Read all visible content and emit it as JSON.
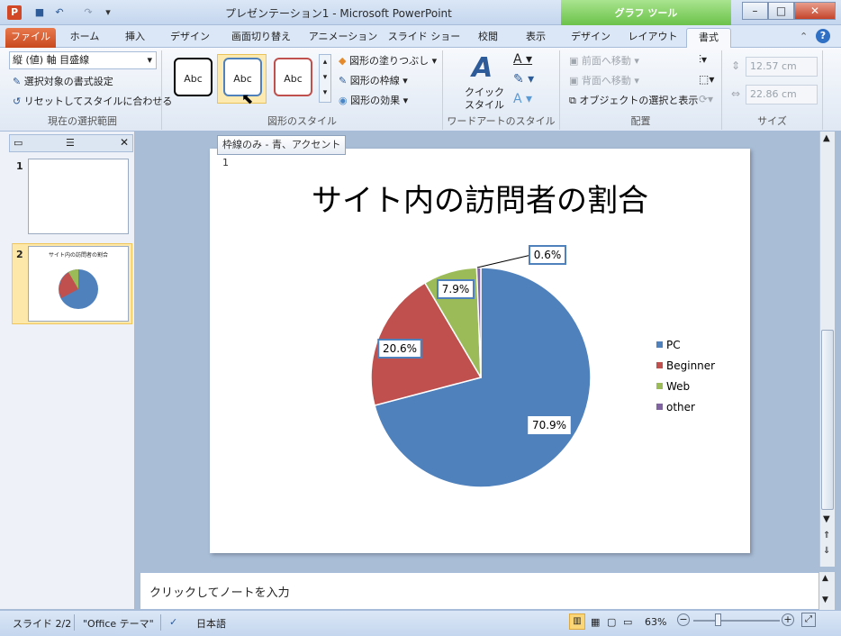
{
  "window": {
    "title": "プレゼンテーション1 - Microsoft PowerPoint",
    "context_tab_title": "グラフ ツール"
  },
  "tabs": [
    "ファイル",
    "ホーム",
    "挿入",
    "デザイン",
    "画面切り替え",
    "アニメーション",
    "スライド ショー",
    "校閲",
    "表示",
    "デザイン",
    "レイアウト",
    "書式"
  ],
  "ribbon": {
    "current_selection": {
      "combo_value": "縦 (値) 軸 目盛線",
      "format_selection": "選択対象の書式設定",
      "reset_style": "リセットしてスタイルに合わせる",
      "group_label": "現在の選択範囲"
    },
    "shape_styles": {
      "sample_text": "Abc",
      "fill": "図形の塗りつぶし",
      "outline": "図形の枠線",
      "effects": "図形の効果",
      "group_label": "図形のスタイル",
      "style_colors": [
        "#000000",
        "#4f81bd",
        "#c0504d"
      ]
    },
    "wordart": {
      "quick_style": "クイック スタイル",
      "group_label": "ワードアートのスタイル"
    },
    "arrange": {
      "bring_forward": "前面へ移動",
      "send_backward": "背面へ移動",
      "selection_pane": "オブジェクトの選択と表示",
      "group_label": "配置"
    },
    "size": {
      "height": "12.57 cm",
      "width": "22.86 cm",
      "group_label": "サイズ"
    }
  },
  "tooltip": "枠線のみ - 青、アクセント 1",
  "slides_pane": {
    "numbers": [
      "1",
      "2"
    ],
    "thumb2_title": "サイト内の訪問者の割合"
  },
  "chart_data": {
    "type": "pie",
    "title": "サイト内の訪問者の割合",
    "categories": [
      "PC",
      "Beginner",
      "Web",
      "other"
    ],
    "values": [
      70.9,
      20.6,
      7.9,
      0.6
    ],
    "labels": [
      "70.9%",
      "20.6%",
      "7.9%",
      "0.6%"
    ],
    "colors": [
      "#4f81bd",
      "#c0504d",
      "#9bbb59",
      "#8064a2"
    ],
    "legend_position": "right"
  },
  "notes_placeholder": "クリックしてノートを入力",
  "status": {
    "slide": "スライド 2/2",
    "theme": "\"Office テーマ\"",
    "language": "日本語",
    "zoom": "63%"
  }
}
